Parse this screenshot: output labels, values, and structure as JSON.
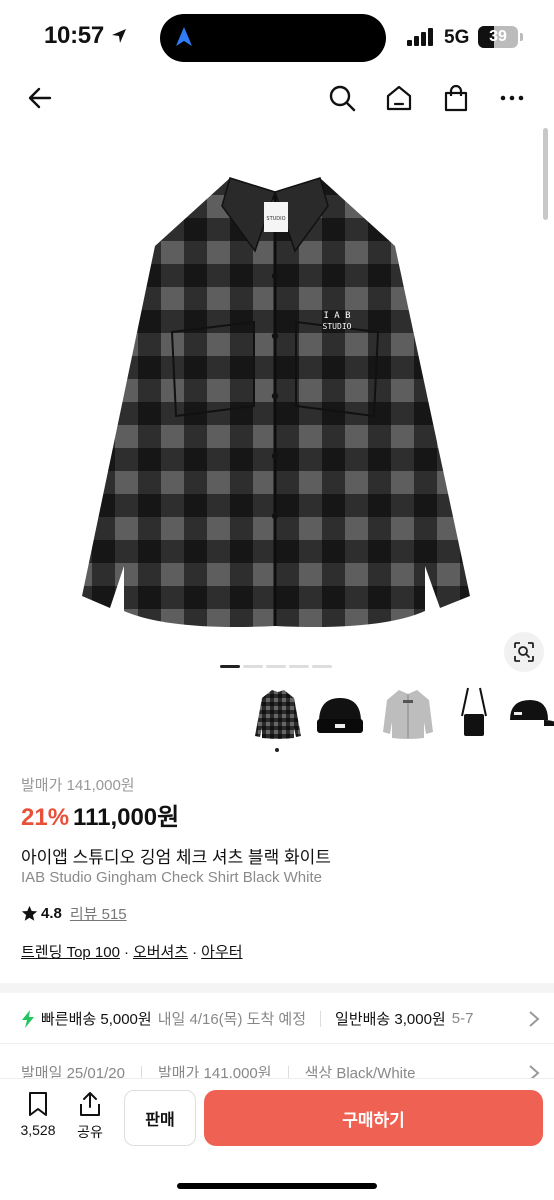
{
  "status": {
    "time": "10:57",
    "network": "5G",
    "battery": "39",
    "battery_level": 0.39
  },
  "nav": {
    "icons": [
      "back-arrow-icon",
      "search-icon",
      "home-icon",
      "shopping-bag-icon",
      "more-icon"
    ]
  },
  "product_image": {
    "brand_mark_line1": "I A B",
    "brand_mark_line2": "STUDIO",
    "tag_text": "STUDIO"
  },
  "gallery": {
    "page_count": 5,
    "active_index": 0
  },
  "thumbnails": [
    "check-shirt",
    "beanie",
    "grey-jacket",
    "crossbody-bag",
    "cap"
  ],
  "product": {
    "original_price": "발매가 141,000원",
    "discount": "21%",
    "price": "111,000원",
    "title_ko": "아이앱 스튜디오 깅엄 체크 셔츠 블랙 화이트",
    "title_en": "IAB Studio Gingham Check Shirt Black White",
    "rating": "4.8",
    "review_label": "리뷰 515",
    "tags": [
      "트렌딩 Top 100",
      "오버셔츠",
      "아우터"
    ],
    "tag_separator": "·"
  },
  "shipping": {
    "fast_label": "빠른배송 5,000원",
    "fast_date": "내일 4/16(목) 도착 예정",
    "normal_label": "일반배송 3,000원",
    "normal_date": "5-7"
  },
  "meta": {
    "release": "발매일 25/01/20",
    "price": "발매가 141,000원",
    "color": "색상 Black/White"
  },
  "bottom_bar": {
    "bookmark_count": "3,528",
    "share_label": "공유",
    "sell_label": "판매",
    "buy_label": "구매하기"
  },
  "colors": {
    "accent": "#ef6253",
    "discount": "#e8503a",
    "bolt": "#22c55e"
  }
}
